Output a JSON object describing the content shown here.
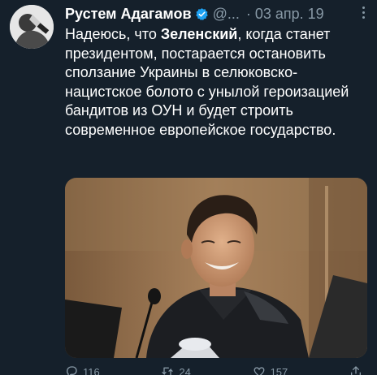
{
  "tweet": {
    "author": {
      "name": "Рустем Адагамов",
      "handle": "@...",
      "verified": true
    },
    "separator": "·",
    "date": "03 апр. 19",
    "text": {
      "part1": "Надеюсь, что ",
      "bold": "Зеленский",
      "part2": ", когда станет президентом, постарается остановить сползание Украины в селюковско-нацистское болото с унылой героизацией бандитов из ОУН и будет строить современное европейское государство."
    },
    "media": {
      "icon": "photo"
    },
    "actions": {
      "reply": {
        "icon": "reply-icon",
        "count": "116"
      },
      "retweet": {
        "icon": "retweet-icon",
        "count": "24"
      },
      "like": {
        "icon": "like-icon",
        "count": "157"
      },
      "share": {
        "icon": "share-icon"
      }
    }
  },
  "colors": {
    "background": "#15202b",
    "text": "#ffffff",
    "secondary": "#8899a6",
    "verified": "#1da1f2"
  }
}
